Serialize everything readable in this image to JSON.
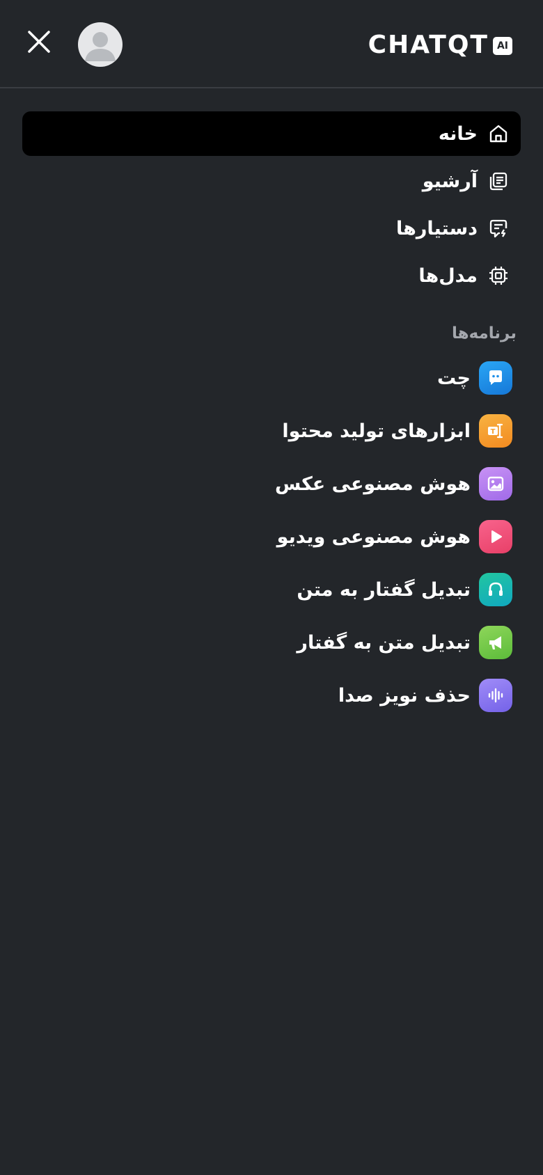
{
  "header": {
    "logo_text": "CHATQT",
    "logo_badge": "AI",
    "close_icon": "close-icon",
    "avatar_icon": "user-avatar-icon"
  },
  "nav": {
    "items": [
      {
        "label": "خانه",
        "icon": "home-icon",
        "active": true
      },
      {
        "label": "آرشیو",
        "icon": "archive-icon",
        "active": false
      },
      {
        "label": "دستیارها",
        "icon": "assistant-chat-icon",
        "active": false
      },
      {
        "label": "مدل‌ها",
        "icon": "cpu-chip-icon",
        "active": false
      }
    ]
  },
  "apps": {
    "title": "برنامه‌ها",
    "items": [
      {
        "label": "چت",
        "icon": "chat-bubble-icon",
        "color": "#1e8fe8"
      },
      {
        "label": "ابزارهای تولید محتوا",
        "icon": "text-tool-icon",
        "color": "#f5a030"
      },
      {
        "label": "هوش مصنوعی عکس",
        "icon": "image-icon",
        "color": "#b57ef0"
      },
      {
        "label": "هوش مصنوعی ویدیو",
        "icon": "play-icon",
        "color": "#f0507a"
      },
      {
        "label": "تبدیل گفتار به متن",
        "icon": "headphones-icon",
        "color": "#1ab7a8"
      },
      {
        "label": "تبدیل متن به گفتار",
        "icon": "megaphone-icon",
        "color": "#7ccc48"
      },
      {
        "label": "حذف نویز صدا",
        "icon": "sound-wave-icon",
        "color": "#8a78f0"
      }
    ]
  },
  "colors": {
    "background": "#23262a",
    "active_item": "#000000",
    "section_title": "#a4a7ad"
  }
}
